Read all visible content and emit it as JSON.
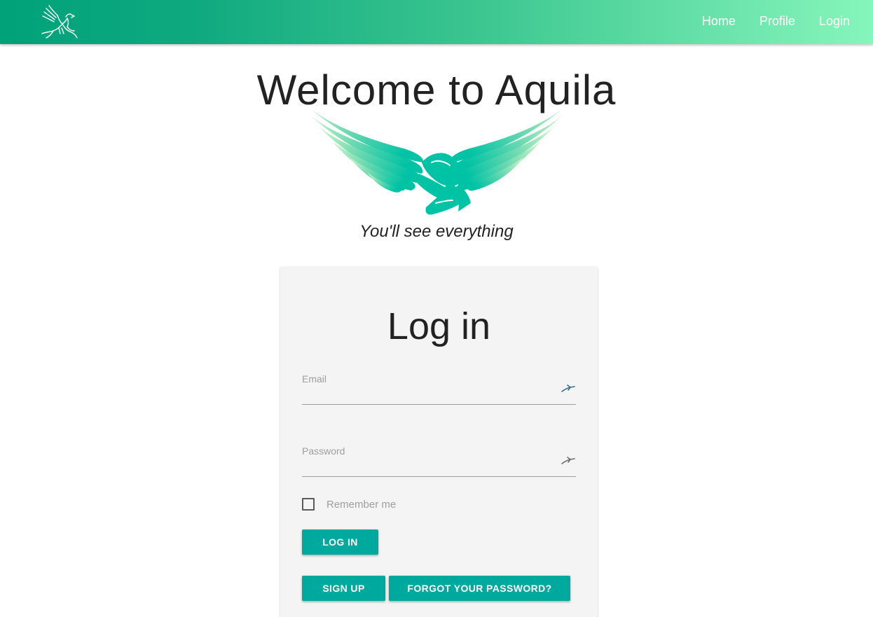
{
  "navbar": {
    "logo": "eagle-logo-icon",
    "links": [
      "Home",
      "Profile",
      "Login"
    ]
  },
  "hero": {
    "title": "Welcome to Aquila",
    "logo": "winged-hands-logo",
    "tagline": "You'll see everything"
  },
  "login": {
    "title": "Log in",
    "email": {
      "label": "Email",
      "value": "",
      "icon": "key-autofill-icon"
    },
    "password": {
      "label": "Password",
      "value": "",
      "icon": "key-autofill-icon"
    },
    "remember_label": "Remember me",
    "remember_checked": false,
    "login_button": "Log in",
    "signup_button": "Sign up",
    "forgot_button": "Forgot your password?"
  },
  "colors": {
    "nav_gradient_start": "#00a27a",
    "nav_gradient_end": "#86f6bb",
    "button": "#00a99d",
    "card_background": "#f4f4f4",
    "wings_start": "#c9f3c5",
    "wings_end": "#00c3a5"
  }
}
